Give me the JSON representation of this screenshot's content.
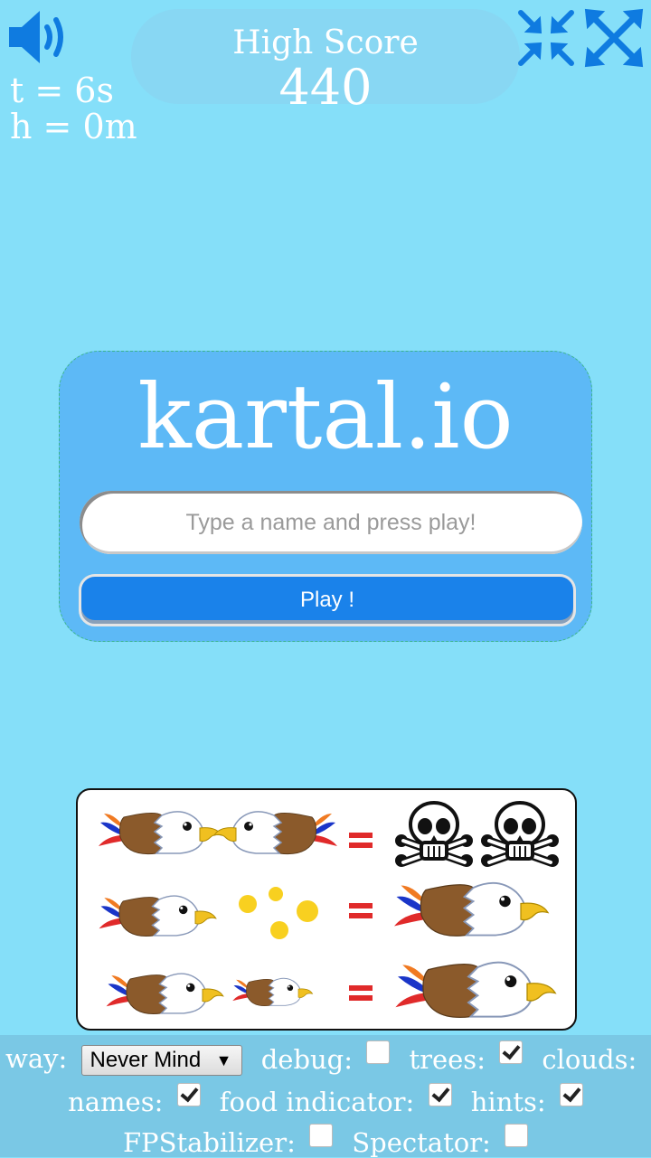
{
  "hud": {
    "sound_icon": "speaker-icon",
    "time_text": "t = 6s",
    "height_text": "h = 0m",
    "high_score_label": "High Score",
    "high_score_value": "440",
    "shrink_icon": "collapse-arrows-icon",
    "close_icon": "close-arrows-icon"
  },
  "menu": {
    "title": "kartal.io",
    "name_placeholder": "Type a name and press play!",
    "name_value": "",
    "play_label": "Play !"
  },
  "hints": {
    "equals": "=",
    "icons": [
      "eagle-icon",
      "skull-crossbones-icon",
      "food-pellet-icon"
    ]
  },
  "settings": {
    "way_label": "way:",
    "way_value": "Never Mind",
    "debug_label": "debug:",
    "debug_checked": false,
    "trees_label": "trees:",
    "trees_checked": true,
    "clouds_label": "clouds:",
    "clouds_checked": true,
    "names_label": "names:",
    "names_checked": true,
    "food_indicator_label": "food indicator:",
    "food_indicator_checked": true,
    "hints_label": "hints:",
    "hints_checked": true,
    "fpstabilizer_label": "FPStabilizer:",
    "fpstabilizer_checked": false,
    "spectator_label": "Spectator:",
    "spectator_checked": false
  },
  "colors": {
    "background": "#85dff9",
    "menu_panel": "#5db9f6",
    "play_button": "#1a82ea",
    "icon_blue": "#0f7be0"
  }
}
